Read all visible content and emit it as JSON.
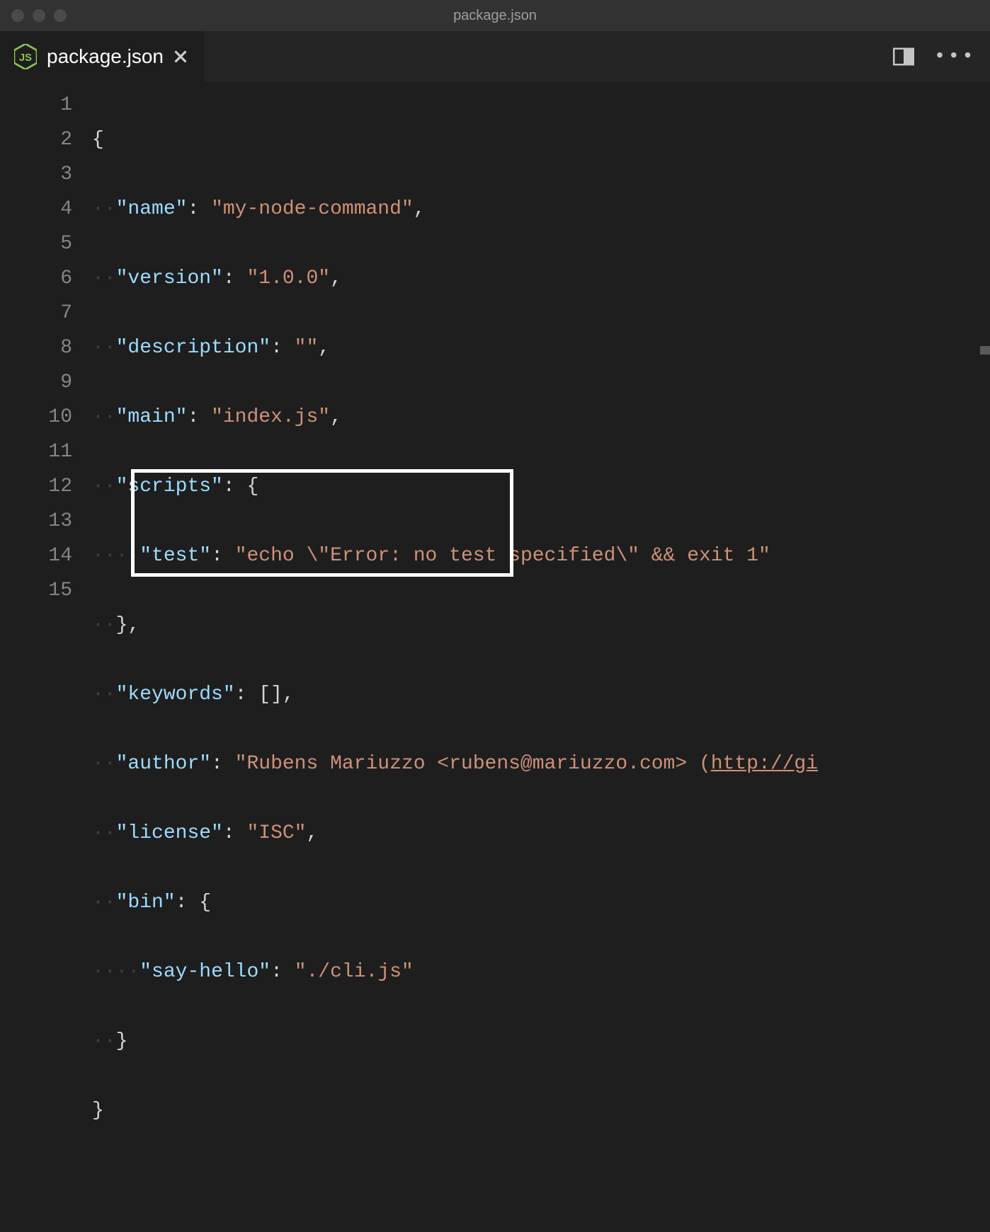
{
  "window": {
    "title": "package.json"
  },
  "tab": {
    "title": "package.json"
  },
  "code": {
    "lines": [
      "1",
      "2",
      "3",
      "4",
      "5",
      "6",
      "7",
      "8",
      "9",
      "10",
      "11",
      "12",
      "13",
      "14",
      "15"
    ],
    "name_key": "\"name\"",
    "name_val": "\"my-node-command\"",
    "version_key": "\"version\"",
    "version_val": "\"1.0.0\"",
    "description_key": "\"description\"",
    "description_val": "\"\"",
    "main_key": "\"main\"",
    "main_val": "\"index.js\"",
    "scripts_key": "\"scripts\"",
    "test_key": "\"test\"",
    "test_val": "\"echo \\\"Error: no test specified\\\" && exit 1\"",
    "keywords_key": "\"keywords\"",
    "keywords_val": "[]",
    "author_key": "\"author\"",
    "author_val_prefix": "\"Rubens Mariuzzo <rubens@mariuzzo.com> (",
    "author_link": "http://gi",
    "license_key": "\"license\"",
    "license_val": "\"ISC\"",
    "bin_key": "\"bin\"",
    "sayhello_key": "\"say-hello\"",
    "sayhello_val": "\"./cli.js\""
  }
}
